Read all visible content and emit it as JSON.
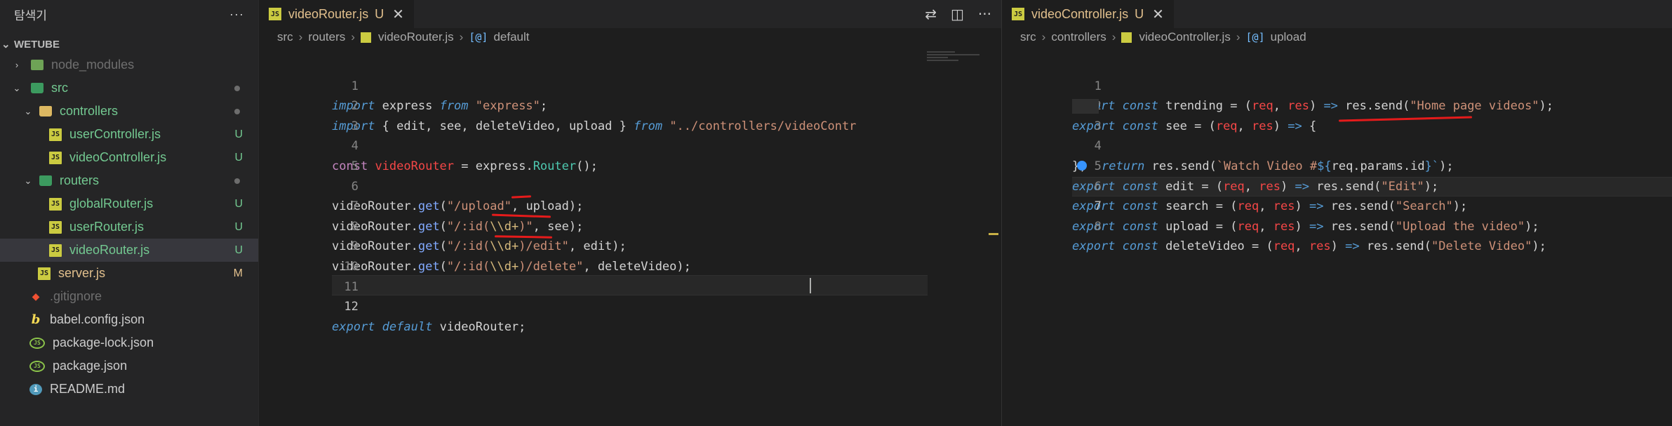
{
  "sidebar": {
    "title": "탐색기",
    "more": "···",
    "section": "WETUBE",
    "items": [
      {
        "label": "node_modules",
        "badge": ""
      },
      {
        "label": "src",
        "badge": ""
      },
      {
        "label": "controllers",
        "badge": ""
      },
      {
        "label": "userController.js",
        "badge": "U"
      },
      {
        "label": "videoController.js",
        "badge": "U"
      },
      {
        "label": "routers",
        "badge": ""
      },
      {
        "label": "globalRouter.js",
        "badge": "U"
      },
      {
        "label": "userRouter.js",
        "badge": "U"
      },
      {
        "label": "videoRouter.js",
        "badge": "U"
      },
      {
        "label": "server.js",
        "badge": "M"
      },
      {
        "label": ".gitignore",
        "badge": ""
      },
      {
        "label": "babel.config.json",
        "badge": ""
      },
      {
        "label": "package-lock.json",
        "badge": ""
      },
      {
        "label": "package.json",
        "badge": ""
      },
      {
        "label": "README.md",
        "badge": ""
      }
    ]
  },
  "left_editor": {
    "tab": {
      "name": "videoRouter.js",
      "badge": "U",
      "close": "✕"
    },
    "breadcrumb": {
      "a": "src",
      "b": "routers",
      "c": "videoRouter.js",
      "d": "default"
    },
    "gutter": [
      "1",
      "2",
      "3",
      "4",
      "5",
      "6",
      "7",
      "8",
      "9",
      "10",
      "11",
      "12"
    ]
  },
  "right_editor": {
    "tab": {
      "name": "videoController.js",
      "badge": "U",
      "close": "✕"
    },
    "breadcrumb": {
      "a": "src",
      "b": "controllers",
      "c": "videoController.js",
      "d": "upload"
    },
    "gutter": [
      "1",
      "2",
      "3",
      "4",
      "5",
      "6",
      "7",
      "8"
    ]
  },
  "code": {
    "import1": "import",
    "express_id": "express",
    "from": "from",
    "express_str": "\"express\"",
    "semi": ";",
    "import_brace_open": "{",
    "edit": "edit",
    "see": "see",
    "deleteVideo": "deleteVideo",
    "upload": "upload",
    "brace_close": "}",
    "controllers_path": "\"../controllers/videoContr",
    "const": "const",
    "videoRouter": "videoRouter",
    "eq": "=",
    "express_call": "express",
    "Router": "Router",
    "call_end": "();",
    "get": "get",
    "upload_path": "\"/upload\"",
    "id_path": "\"/:id(",
    "esc": "\\\\d+",
    "id_close": ")\"",
    "id_edit_close": ")/edit\"",
    "id_delete_close": ")/delete\"",
    "export": "export",
    "default": "default",
    "trending": "trending",
    "search": "search",
    "req": "req",
    "res": "res",
    "arrow": "=>",
    "res_send": "res.send",
    "home_str": "\"Home page videos\"",
    "return": "return",
    "watch_tpl_start": "`Watch Video #",
    "dollar": "${",
    "params": "req.params.id",
    "tpl_end": "}`",
    "close_block": "};",
    "edit_str": "\"Edit\"",
    "search_str": "\"Search\"",
    "upload_str": "\"Upload the video\"",
    "delete_str": "\"Delete Video\"",
    "paren_open": "(",
    "paren_close": ")",
    "comma": ",",
    "dot": ".",
    "see_open": "{"
  }
}
